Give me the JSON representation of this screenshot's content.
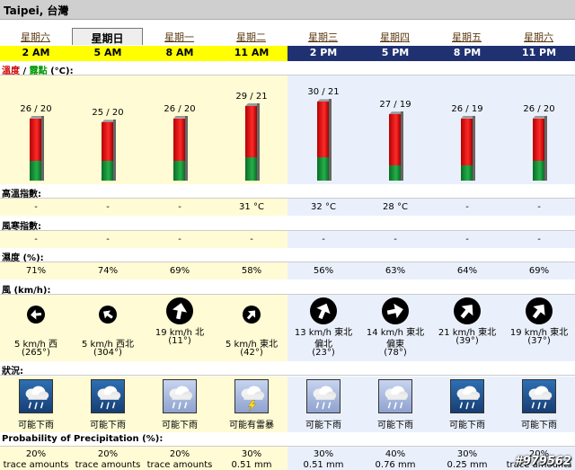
{
  "location": "Taipei, 台灣",
  "days": [
    "星期六",
    "星期日",
    "星期一",
    "星期二",
    "星期三",
    "星期四",
    "星期五",
    "星期六"
  ],
  "times": [
    "2 AM",
    "5 AM",
    "8 AM",
    "11 AM",
    "2 PM",
    "5 PM",
    "8 PM",
    "11 PM"
  ],
  "labels": {
    "temp_red": "溫度",
    "temp_sep": " / ",
    "temp_green": "露點",
    "temp_unit": " (°C):",
    "heat": "高溫指數:",
    "windchill": "風寒指數:",
    "humidity": "濕度 (%):",
    "wind": "風 (km/h):",
    "condition": "狀況:",
    "pop": "Probability of Precipitation (%):"
  },
  "temps": [
    "26 / 20",
    "25 / 20",
    "26 / 20",
    "29 / 21",
    "30 / 21",
    "27 / 19",
    "26 / 19",
    "26 / 20"
  ],
  "chart_data": {
    "type": "bar",
    "categories": [
      "2 AM",
      "5 AM",
      "8 AM",
      "11 AM",
      "2 PM",
      "5 PM",
      "8 PM",
      "11 PM"
    ],
    "series": [
      {
        "name": "溫度",
        "values": [
          26,
          25,
          26,
          29,
          30,
          27,
          26,
          26
        ]
      },
      {
        "name": "露點",
        "values": [
          20,
          20,
          20,
          21,
          21,
          19,
          19,
          20
        ]
      }
    ]
  },
  "heat_index": [
    "-",
    "-",
    "-",
    "31 °C",
    "32 °C",
    "28 °C",
    "-",
    "-"
  ],
  "wind_chill": [
    "-",
    "-",
    "-",
    "-",
    "-",
    "-",
    "-",
    "-"
  ],
  "humidity": [
    "71%",
    "74%",
    "69%",
    "58%",
    "56%",
    "63%",
    "64%",
    "69%"
  ],
  "wind": {
    "line1": [
      "5 km/h 西",
      "5 km/h 西北",
      "19 km/h 北",
      "5 km/h 東北",
      "13 km/h 東北",
      "14 km/h 東北",
      "21 km/h 東北",
      "19 km/h 東北"
    ],
    "line2": [
      "(265°)",
      "(304°)",
      "(11°)",
      "(42°)",
      "偏北",
      "偏東",
      "(39°)",
      "(37°)"
    ],
    "line3": [
      "",
      "",
      "",
      "",
      "(23°)",
      "(78°)",
      "",
      ""
    ]
  },
  "conditions": [
    "可能下雨",
    "可能下雨",
    "可能下雨",
    "可能有雷暴",
    "可能下雨",
    "可能下雨",
    "可能下雨",
    "可能下雨"
  ],
  "pop": [
    "20%",
    "20%",
    "20%",
    "30%",
    "30%",
    "40%",
    "30%",
    "20%"
  ],
  "amounts": [
    "trace amounts",
    "trace amounts",
    "trace amounts",
    "0.51 mm",
    "0.51 mm",
    "0.76 mm",
    "0.25 mm",
    "trace amounts"
  ],
  "watermark": "#979562",
  "colors": {
    "day_bg": "#fffbd4",
    "night_bg": "#eaf0fb",
    "day_header": "#ffff00",
    "night_header": "#1f3170"
  }
}
